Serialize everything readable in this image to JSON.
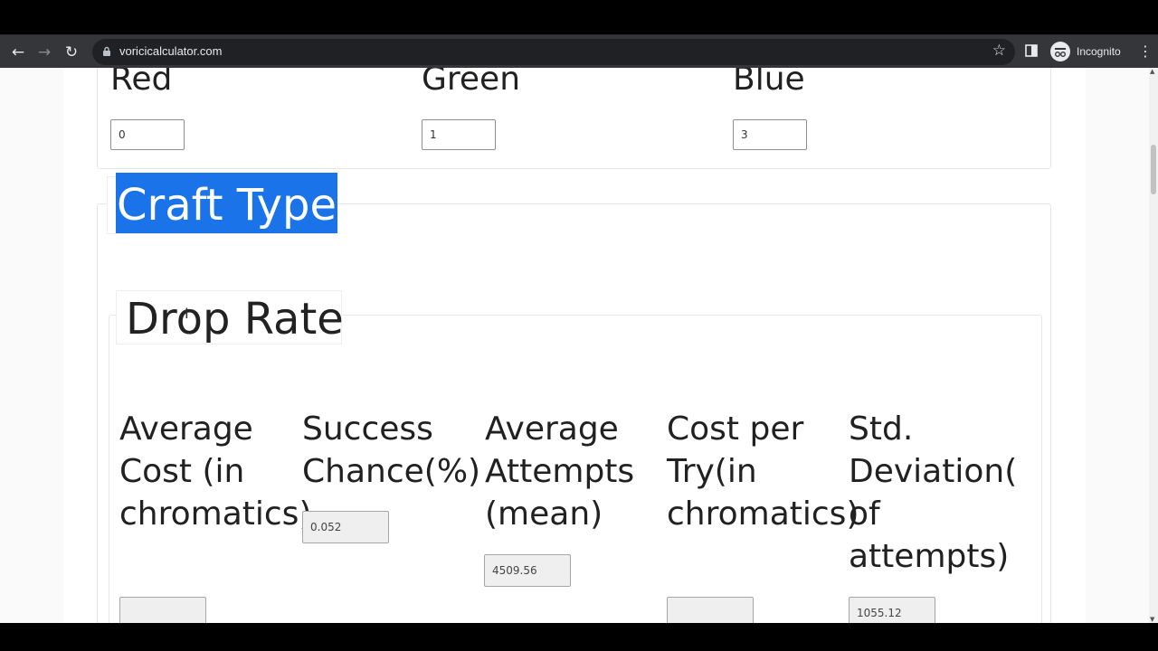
{
  "browser": {
    "url": "voricicalculator.com",
    "profile_label": "Incognito",
    "icons": {
      "back": "←",
      "forward": "→",
      "reload": "↻",
      "bookmark": "☆",
      "menu": "⋮"
    }
  },
  "colors_section": {
    "red": {
      "label": "Red",
      "value": "0"
    },
    "green": {
      "label": "Green",
      "value": "1"
    },
    "blue": {
      "label": "Blue",
      "value": "3"
    }
  },
  "craft_type": {
    "legend": "Craft Type"
  },
  "drop_rate": {
    "legend": "Drop Rate",
    "columns": [
      {
        "label": "Average Cost (in chromatics)",
        "value": ""
      },
      {
        "label": "Success Chance(%)",
        "value": "0.052"
      },
      {
        "label": "Average Attempts (mean)",
        "value": "4509.56"
      },
      {
        "label": "Cost per Try(in chromatics)",
        "value": ""
      },
      {
        "label": "Std. Deviation( of attempts)",
        "value": "1055.12"
      }
    ]
  },
  "theme": {
    "selection_color": "#1a73e8",
    "chrome_bg": "#35363a"
  }
}
